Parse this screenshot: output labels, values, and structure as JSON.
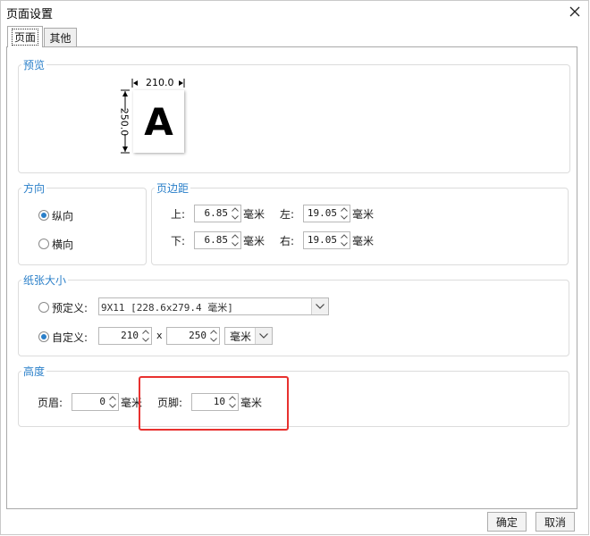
{
  "window": {
    "title": "页面设置",
    "close_icon": "close-icon"
  },
  "tabs": [
    {
      "label": "页面",
      "active": true
    },
    {
      "label": "其他",
      "active": false
    }
  ],
  "preview": {
    "group_title": "预览",
    "width_value": "210.0",
    "height_value": "250.0",
    "paper_letter": "A"
  },
  "orientation": {
    "group_title": "方向",
    "options": [
      {
        "label": "纵向",
        "checked": true
      },
      {
        "label": "横向",
        "checked": false
      }
    ]
  },
  "margins": {
    "group_title": "页边距",
    "top": {
      "label": "上:",
      "value": "6.85",
      "unit": "毫米"
    },
    "left": {
      "label": "左:",
      "value": "19.05",
      "unit": "毫米"
    },
    "bottom": {
      "label": "下:",
      "value": "6.85",
      "unit": "毫米"
    },
    "right": {
      "label": "右:",
      "value": "19.05",
      "unit": "毫米"
    }
  },
  "paper_size": {
    "group_title": "纸张大小",
    "predefined": {
      "label": "预定义:",
      "checked": false,
      "value": "9X11 [228.6x279.4 毫米]"
    },
    "custom": {
      "label": "自定义:",
      "checked": true,
      "width": "210",
      "separator": "x",
      "height": "250",
      "unit": "毫米"
    }
  },
  "height_section": {
    "group_title": "高度",
    "header": {
      "label": "页眉:",
      "value": "0",
      "unit": "毫米"
    },
    "footer": {
      "label": "页脚:",
      "value": "10",
      "unit": "毫米"
    }
  },
  "buttons": {
    "ok": "确定",
    "cancel": "取消"
  },
  "colors": {
    "accent": "#2a7fc9",
    "highlight": "#e8312f"
  }
}
